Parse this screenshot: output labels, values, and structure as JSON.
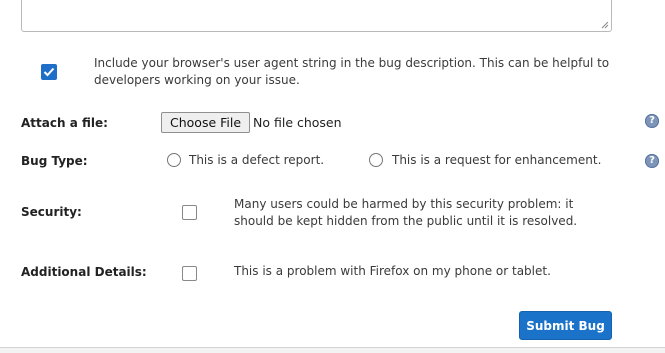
{
  "user_agent": {
    "checked": true,
    "text": "Include your browser's user agent string in the bug description. This can be helpful to developers working on your issue."
  },
  "attach": {
    "label": "Attach a file:",
    "button_label": "Choose File",
    "status": "No file chosen",
    "help": "?"
  },
  "bug_type": {
    "label": "Bug Type:",
    "options": [
      {
        "label": "This is a defect report.",
        "selected": false
      },
      {
        "label": "This is a request for enhancement.",
        "selected": false
      }
    ],
    "help": "?"
  },
  "security": {
    "label": "Security:",
    "checked": false,
    "text": "Many users could be harmed by this security problem: it should be kept hidden from the public until it is resolved."
  },
  "additional": {
    "label": "Additional Details:",
    "checked": false,
    "text": "This is a problem with Firefox on my phone or tablet."
  },
  "submit_label": "Submit Bug"
}
